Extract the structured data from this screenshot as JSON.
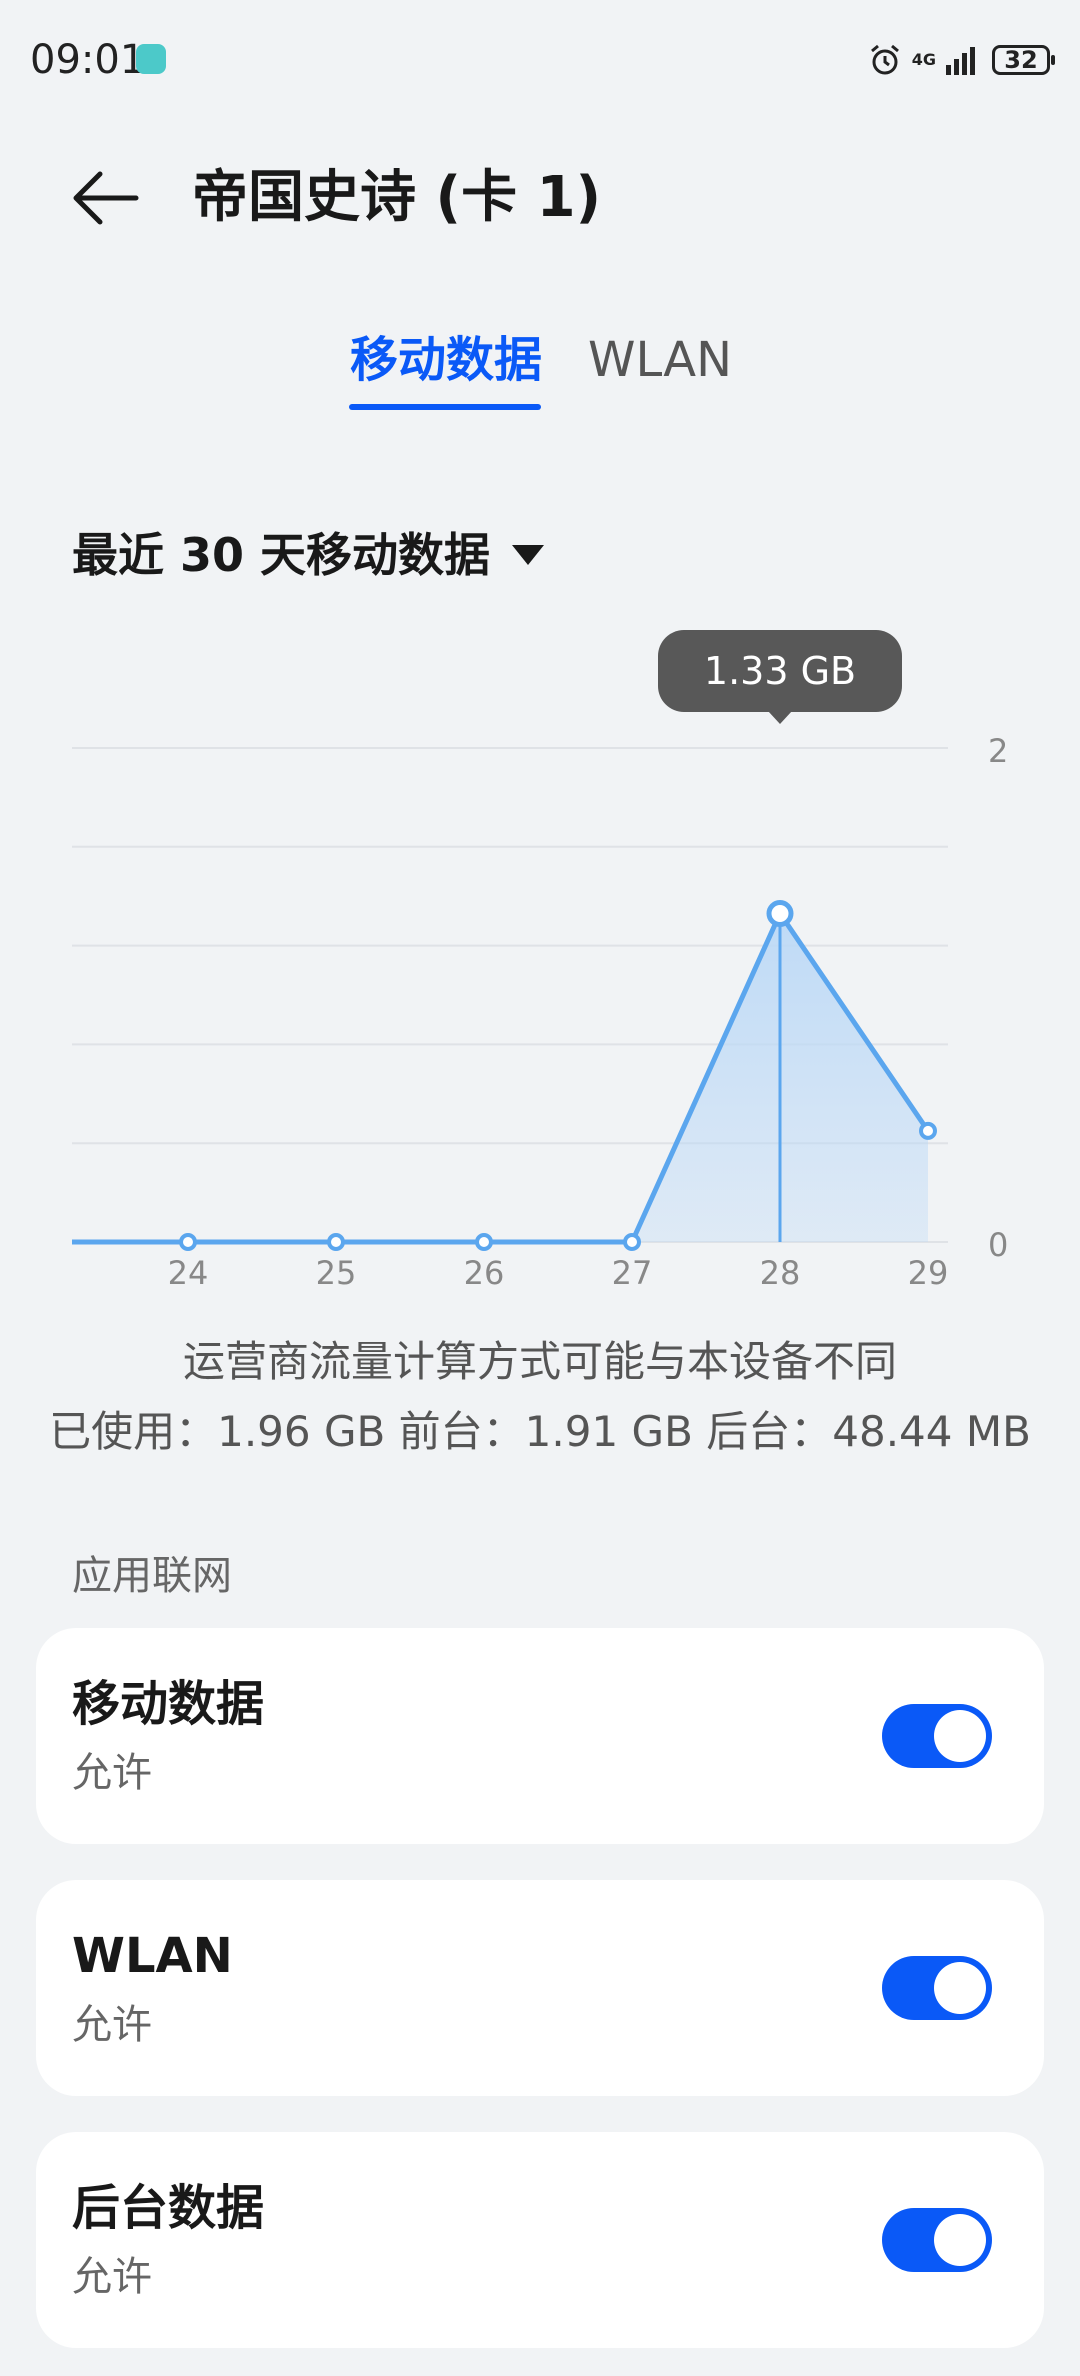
{
  "status_bar": {
    "time": "09:01",
    "network": "4G",
    "battery": "32",
    "icons": [
      "download-notification-icon",
      "alarm-icon",
      "signal-icon",
      "battery-icon"
    ]
  },
  "header": {
    "title": "帝国史诗 (卡 1)",
    "back_icon": "arrow-left-icon"
  },
  "tabs": [
    {
      "label": "移动数据",
      "active": true
    },
    {
      "label": "WLAN",
      "active": false
    }
  ],
  "range_selector": {
    "label": "最近 30 天移动数据",
    "icon": "caret-down-icon"
  },
  "chart_data": {
    "type": "area",
    "x": [
      "24",
      "25",
      "26",
      "27",
      "28",
      "29"
    ],
    "y_tick_labels": [
      "2",
      "0"
    ],
    "y_range": [
      0,
      2
    ],
    "values": [
      0,
      0,
      0,
      0,
      1.33,
      0.45
    ],
    "selected_index": 4,
    "tooltip": "1.33 GB",
    "grid": true,
    "colors": {
      "line": "#5ba6ee",
      "fill": "#bcd9f6",
      "grid": "#dfe2e6",
      "tooltip_bg": "#585858"
    }
  },
  "notes": {
    "disclaimer": "运营商流量计算方式可能与本设备不同",
    "usage": "已使用：1.96 GB  前台：1.91 GB  后台：48.44 MB"
  },
  "section": {
    "label": "应用联网"
  },
  "settings": [
    {
      "title": "移动数据",
      "subtitle": "允许",
      "enabled": true
    },
    {
      "title": "WLAN",
      "subtitle": "允许",
      "enabled": true
    },
    {
      "title": "后台数据",
      "subtitle": "允许",
      "enabled": true
    }
  ],
  "colors": {
    "accent": "#0a59f7",
    "background": "#f1f3f5",
    "card": "#ffffff"
  }
}
